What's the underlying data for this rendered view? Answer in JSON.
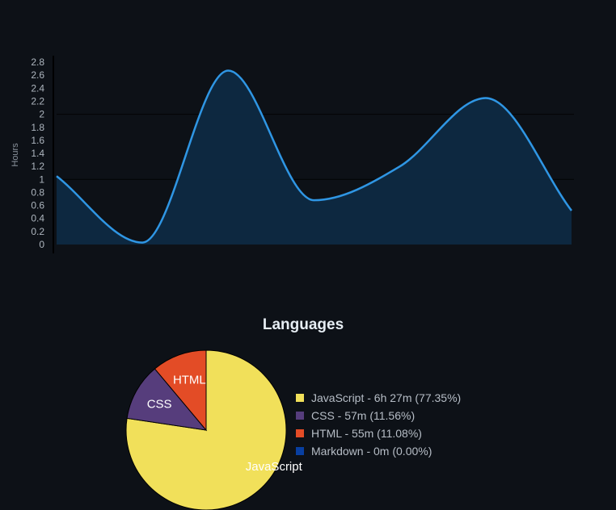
{
  "chart_data": [
    {
      "type": "area",
      "title": "",
      "xlabel": "",
      "ylabel": "Hours",
      "ylim": [
        0,
        2.9
      ],
      "yticks": [
        "0",
        "0.2",
        "0.4",
        "0.6",
        "0.8",
        "1",
        "1.2",
        "1.4",
        "1.6",
        "1.8",
        "2",
        "2.2",
        "2.4",
        "2.6",
        "2.8"
      ],
      "x": [
        0,
        1,
        2,
        3,
        4,
        5,
        6
      ],
      "series": [
        {
          "values": [
            1.05,
            0.03,
            2.67,
            0.68,
            1.2,
            2.25,
            0.52
          ]
        }
      ],
      "grid": "horizontal lines at 1 and 2",
      "colors": {
        "line": "#2f96e4",
        "fill": "#0e2a42",
        "axis": "#000000",
        "tick_text": "#aeb6bf",
        "grid": "#000000"
      }
    },
    {
      "type": "pie",
      "title": "Languages",
      "categories": [
        "JavaScript",
        "CSS",
        "HTML",
        "Markdown"
      ],
      "values": [
        77.35,
        11.56,
        11.08,
        0.0
      ],
      "slice_labels": [
        "JavaScript",
        "CSS",
        "HTML",
        ""
      ],
      "legend": [
        "JavaScript - 6h 27m (77.35%)",
        "CSS - 57m (11.56%)",
        "HTML - 55m (11.08%)",
        "Markdown - 0m (0.00%)"
      ],
      "legend_position": "right",
      "colors": [
        "#f1e05a",
        "#563d7c",
        "#e34c26",
        "#083fa1"
      ]
    }
  ]
}
